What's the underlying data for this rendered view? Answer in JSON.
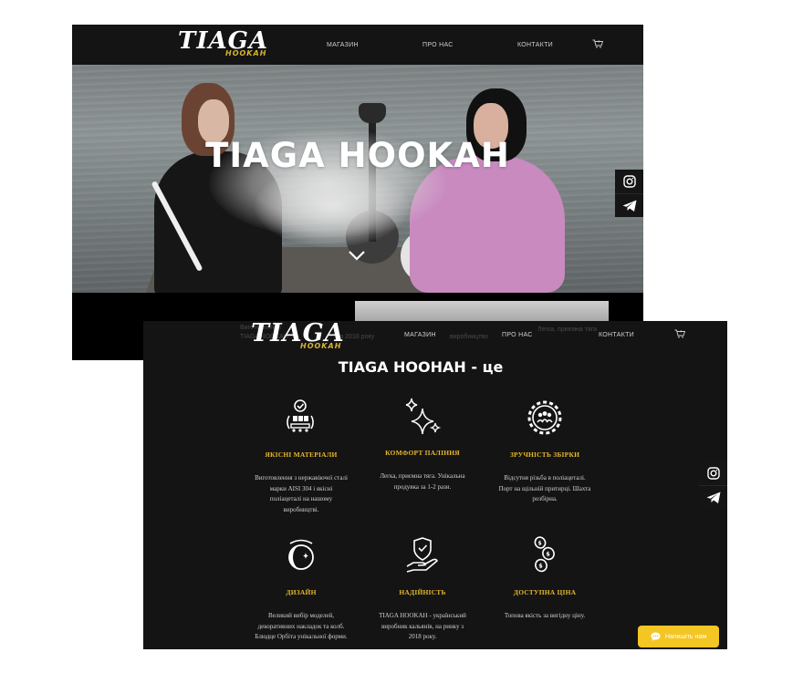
{
  "back_page": {
    "logo": {
      "main": "TIAGA",
      "sub": "HOOKAH"
    },
    "nav": {
      "shop": "МАГАЗИН",
      "about": "ПРО НАС",
      "contacts": "КОНТАКТИ"
    },
    "hero": {
      "title": "TIAGA HOOKAH"
    },
    "social": [
      "instagram-icon",
      "telegram-icon"
    ]
  },
  "front_page": {
    "logo": {
      "main": "TIAGA",
      "sub": "HOOKAH"
    },
    "nav": {
      "shop": "МАГАЗИН",
      "about": "ПРО НАС",
      "contacts": "КОНТАКТИ"
    },
    "section_title": "TIAGA HOOHAH - це",
    "features": [
      {
        "icon": "materials-icon",
        "title": "ЯКІСНІ МАТЕРІАЛИ",
        "desc": "Виготовлення з нержавіючої сталі марки AISI 304 і якісні поліацеталі на нашому виробництві."
      },
      {
        "icon": "sparkles-icon",
        "title": "КОМФОРТ ПАЛІННЯ",
        "desc": "Легка, приємна тяга. Унікальна продувка за 1-2 рази."
      },
      {
        "icon": "gear-people-icon",
        "title": "ЗРУЧНІСТЬ ЗБІРКИ",
        "desc": "Відсутня різьба в поліацеталі. Порт на щільній притирці. Шахта розбірна."
      },
      {
        "icon": "design-icon",
        "title": "ДИЗАЙН",
        "desc": "Великий вибір моделей, декоративних накладок та колб. Блюдце Орбіта унікальної форми."
      },
      {
        "icon": "shield-hand-icon",
        "title": "НАДІЙНІСТЬ",
        "desc": "TIAGA HOOKAH - український виробник кальянів, на ринку з 2018 року."
      },
      {
        "icon": "coins-icon",
        "title": "ДОСТУПНА ЦІНА",
        "desc": "Топова якість за вигідну ціну."
      }
    ],
    "chat_button": "Напишіть нам",
    "social": [
      "instagram-icon",
      "telegram-icon"
    ]
  },
  "colors": {
    "accent": "#e5b72f",
    "chat": "#f3c623",
    "bg": "#141414"
  }
}
